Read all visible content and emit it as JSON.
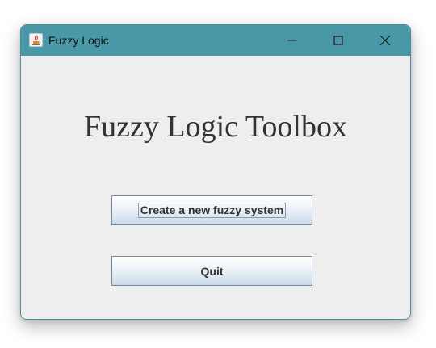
{
  "window": {
    "title": "Fuzzy Logic",
    "app_icon": "java-cup-icon",
    "controls": {
      "minimize": "minimize-icon",
      "maximize": "maximize-icon",
      "close": "close-icon"
    },
    "titlebar_color": "#4898a8"
  },
  "main": {
    "heading": "Fuzzy Logic Toolbox",
    "buttons": {
      "create_label": "Create a new fuzzy system",
      "quit_label": "Quit"
    }
  }
}
